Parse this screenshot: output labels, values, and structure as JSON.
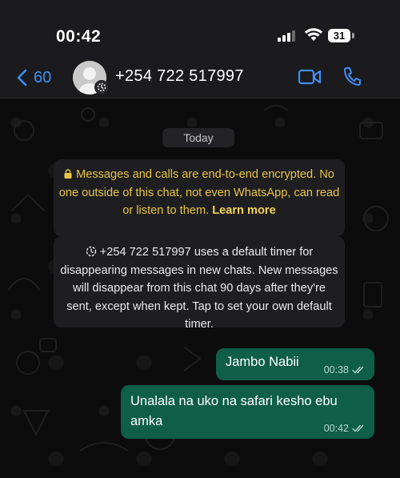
{
  "status_bar": {
    "time": "00:42",
    "battery": "31"
  },
  "header": {
    "back_count": "60",
    "contact_name": "+254 722 517997",
    "accent_color": "#3e8ef7"
  },
  "chat": {
    "date_label": "Today",
    "encryption_notice": {
      "text": "Messages and calls are end-to-end encrypted. No one outside of this chat, not even WhatsApp, can read or listen to them.",
      "link": "Learn more"
    },
    "timer_notice": {
      "text": "+254 722 517997 uses a default timer for disappearing messages in new chats. New messages will disappear from this chat 90 days after they're sent, except when kept. Tap to set your own default timer."
    },
    "messages": [
      {
        "text": "Jambo Nabii",
        "time": "00:38"
      },
      {
        "text": "Unalala na uko na safari kesho ebu amka",
        "time": "00:42"
      }
    ]
  },
  "icons": [
    "back-chevron-icon",
    "avatar-icon",
    "video-call-icon",
    "phone-call-icon",
    "lock-icon",
    "timer-icon",
    "read-ticks-icon",
    "signal-icon",
    "wifi-icon",
    "battery-icon"
  ]
}
